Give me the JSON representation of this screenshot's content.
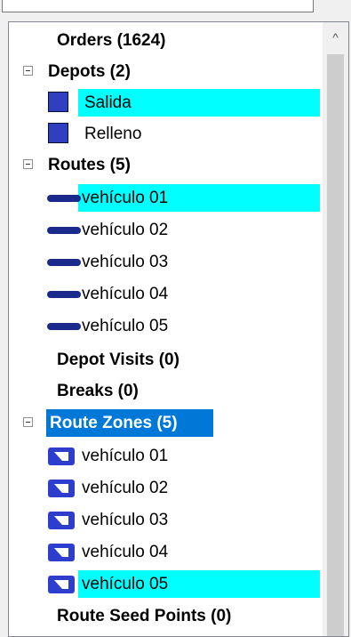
{
  "tree": {
    "orders": "Orders (1624)",
    "depots": {
      "label": "Depots (2)",
      "items": [
        "Salida",
        "Relleno"
      ]
    },
    "routes": {
      "label": "Routes (5)",
      "items": [
        "vehículo 01",
        "vehículo 02",
        "vehículo 03",
        "vehículo 04",
        "vehículo 05"
      ]
    },
    "depot_visits": "Depot Visits (0)",
    "breaks": "Breaks (0)",
    "route_zones": {
      "label": "Route Zones (5)",
      "items": [
        "vehículo 01",
        "vehículo 02",
        "vehículo 03",
        "vehículo 04",
        "vehículo 05"
      ]
    },
    "route_seed_points": "Route Seed Points (0)"
  },
  "scrollbar": {
    "up_arrow": "^"
  },
  "colors": {
    "selection_highlight": "#00ffff",
    "focus_highlight": "#0078d7",
    "depot_icon": "#2f3fbf",
    "route_line": "#1a2a8c",
    "zone_icon": "#2d3ecf"
  },
  "icons": {
    "collapse": "minus-box-icon",
    "depot": "depot-square-icon",
    "route": "route-line-icon",
    "zone": "zone-polygon-icon"
  }
}
